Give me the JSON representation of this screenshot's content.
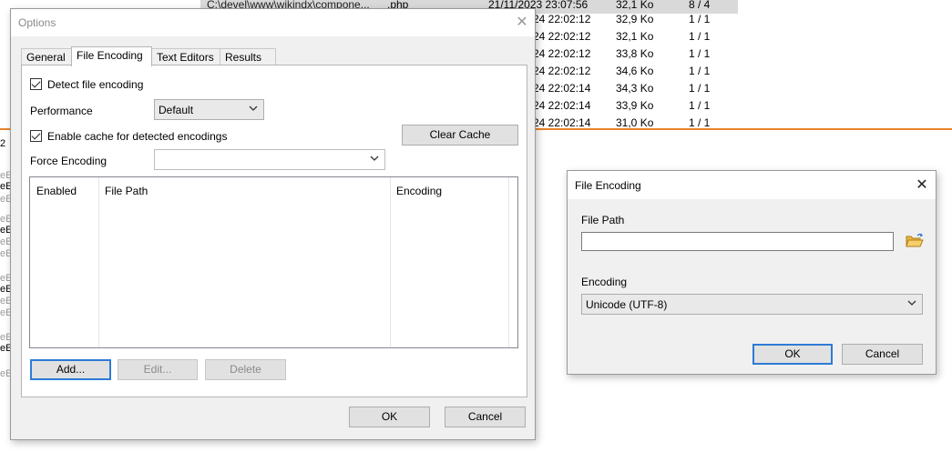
{
  "background": {
    "rows": [
      {
        "path": "C:\\devel\\www\\wikindx\\compone...",
        "ext": ".php",
        "date": "21/11/2023 23:07:56",
        "size": "32,1 Ko",
        "count": "8 / 4"
      },
      {
        "path": "",
        "ext": "",
        "date": "24 22:02:12",
        "size": "32,9 Ko",
        "count": "1 / 1"
      },
      {
        "path": "",
        "ext": "",
        "date": "24 22:02:12",
        "size": "32,1 Ko",
        "count": "1 / 1"
      },
      {
        "path": "",
        "ext": "",
        "date": "24 22:02:12",
        "size": "33,8 Ko",
        "count": "1 / 1"
      },
      {
        "path": "",
        "ext": "",
        "date": "24 22:02:12",
        "size": "34,6 Ko",
        "count": "1 / 1"
      },
      {
        "path": "",
        "ext": "",
        "date": "24 22:02:14",
        "size": "34,3 Ko",
        "count": "1 / 1"
      },
      {
        "path": "",
        "ext": "",
        "date": "24 22:02:14",
        "size": "33,9 Ko",
        "count": "1 / 1"
      },
      {
        "path": "",
        "ext": "",
        "date": "24 22:02:14",
        "size": "31,0 Ko",
        "count": "1 / 1"
      }
    ],
    "left_strip": [
      "2",
      "eE",
      "eE",
      "eE",
      "eE",
      "eE",
      "eE",
      "eE",
      "eE",
      "eE",
      "eE",
      "eE",
      "eE",
      "eE",
      "eE"
    ]
  },
  "options": {
    "title": "Options",
    "tabs": [
      "General",
      "File Encoding",
      "Text Editors",
      "Results"
    ],
    "detect_label": "Detect file encoding",
    "performance_label": "Performance",
    "performance_value": "Default",
    "cache_label": "Enable cache for detected encodings",
    "clear_cache": "Clear Cache",
    "force_label": "Force Encoding",
    "force_value": "",
    "columns": [
      "Enabled",
      "File Path",
      "Encoding"
    ],
    "add": "Add...",
    "edit": "Edit...",
    "delete": "Delete",
    "ok": "OK",
    "cancel": "Cancel"
  },
  "file_encoding": {
    "title": "File Encoding",
    "path_label": "File Path",
    "path_value": "",
    "encoding_label": "Encoding",
    "encoding_value": "Unicode (UTF-8)",
    "ok": "OK",
    "cancel": "Cancel"
  },
  "colors": {
    "accent": "#2d7bd6",
    "orange_line": "#e8832a",
    "folder": "#e8b540"
  }
}
